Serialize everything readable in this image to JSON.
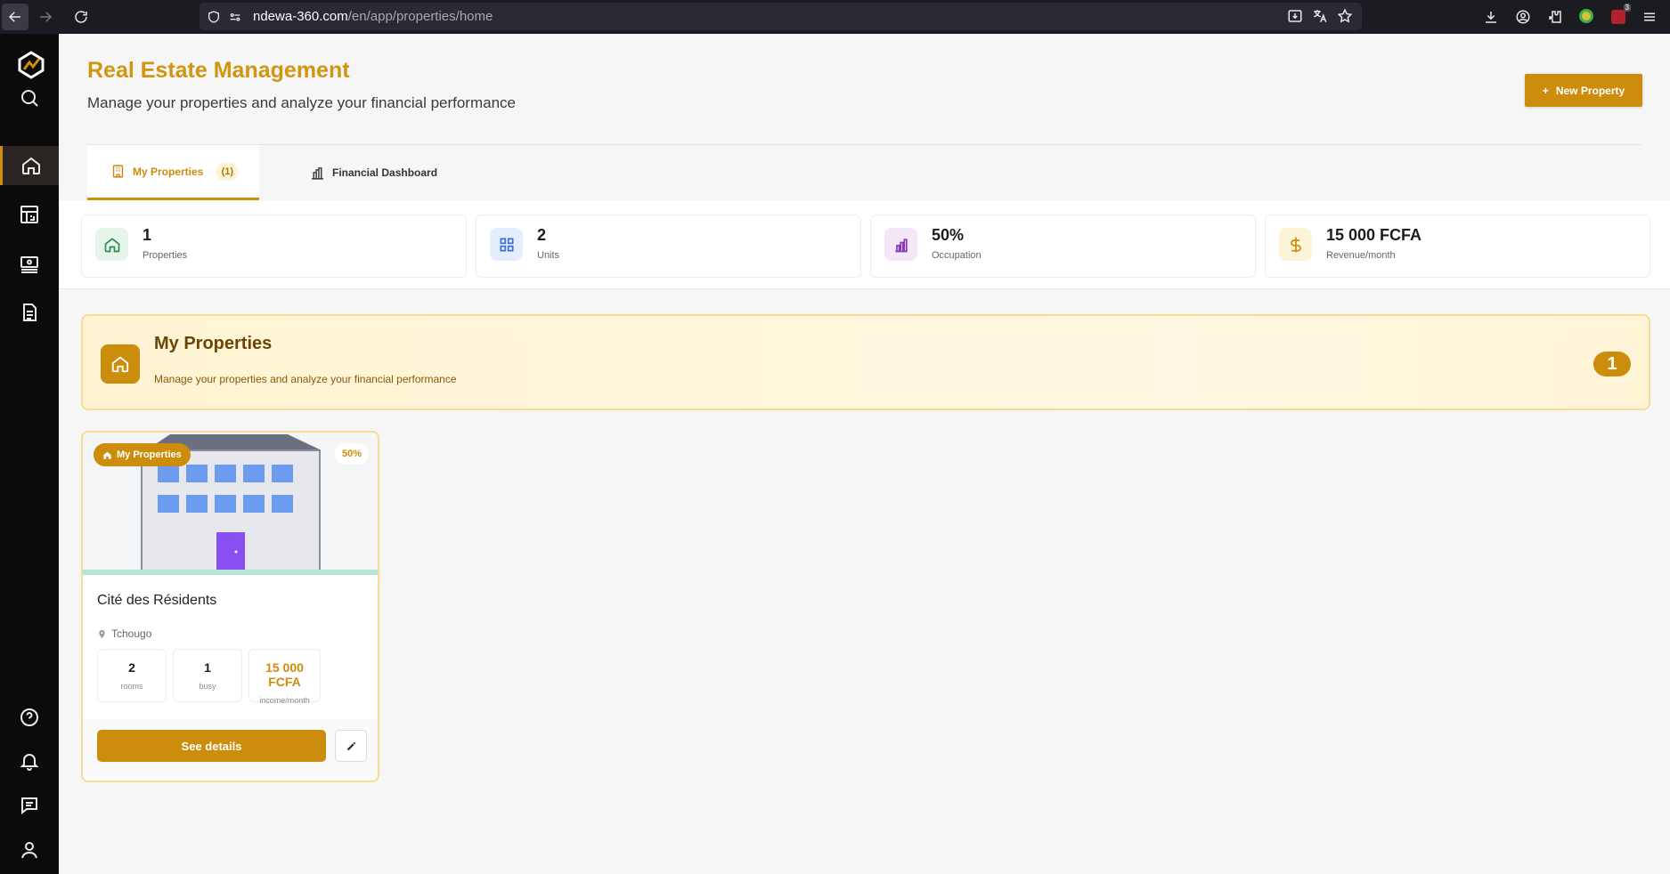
{
  "browser": {
    "url_domain": "ndewa-360.com",
    "url_path": "/en/app/properties/home",
    "extension_badge": "3"
  },
  "header": {
    "title": "Real Estate Management",
    "subtitle": "Manage your properties and analyze your financial performance",
    "new_property_label": "New Property"
  },
  "tabs": [
    {
      "label": "My Properties",
      "count": "(1)",
      "icon": "building-icon"
    },
    {
      "label": "Financial Dashboard",
      "icon": "chart-bars-icon"
    }
  ],
  "stats": [
    {
      "value": "1",
      "label": "Properties",
      "icon": "home-icon",
      "color": "#2e8b4f"
    },
    {
      "value": "2",
      "label": "Units",
      "icon": "grid-icon",
      "color": "#3b6fd8"
    },
    {
      "value": "50%",
      "label": "Occupation",
      "icon": "bar-chart-icon",
      "color": "#8a3ab9"
    },
    {
      "value": "15 000 FCFA",
      "label": "Revenue/month",
      "icon": "dollar-icon",
      "color": "#cc8c0c"
    }
  ],
  "banner": {
    "title": "My Properties",
    "subtitle": "Manage your properties and analyze your financial performance",
    "count": "1"
  },
  "property_card": {
    "badge": "My Properties",
    "occupancy": "50%",
    "name": "Cité des Résidents",
    "location": "Tchougo",
    "rooms_value": "2",
    "rooms_label": "rooms",
    "busy_value": "1",
    "busy_label": "busy",
    "income_value": "15 000 FCFA",
    "income_label": "income/month",
    "details_label": "See details"
  },
  "colors": {
    "accent": "#cc8c0c",
    "title": "#d1950f",
    "sidebar": "#0b0b0c"
  }
}
